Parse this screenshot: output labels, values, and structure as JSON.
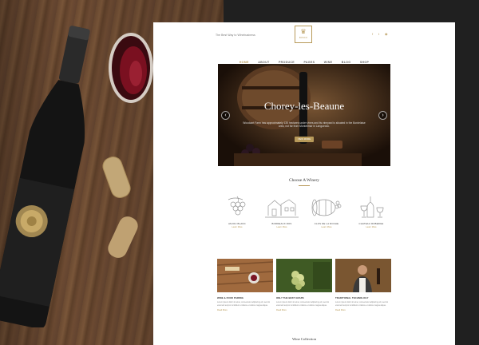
{
  "site": {
    "tagline": "The Best Way to Winebusiness",
    "logo_text": "BOSCO",
    "social_icons": [
      "facebook-icon",
      "twitter-icon",
      "rss-icon"
    ],
    "nav": [
      {
        "label": "HOME",
        "active": true
      },
      {
        "label": "ABOUT"
      },
      {
        "label": "PRODUCE"
      },
      {
        "label": "PAGES"
      },
      {
        "label": "WINE"
      },
      {
        "label": "BLOG"
      },
      {
        "label": "SHOP"
      }
    ]
  },
  "hero": {
    "title": "Chorey-les-Beaune",
    "text": "Woodcart Farm has approximately 135 hectares under vines and its vineyard is situated in the Bordelaise area, not far from Montelimar in Languedoc.",
    "button": "VIEW MORE"
  },
  "wineries": {
    "title": "Choose A Winery",
    "items": [
      {
        "name": "ANJOU BLANC",
        "link": "Learn More"
      },
      {
        "name": "BORDEAUX ROS",
        "link": "Learn More"
      },
      {
        "name": "CLOS DE LA ROCHE",
        "link": "Learn More"
      },
      {
        "name": "CHATEAU ROBERGE",
        "link": "Learn More"
      }
    ]
  },
  "posts": [
    {
      "title": "WINE & FOOD PAIRING",
      "text": "Lorem ipsum dolor sit amet, consectetur adipiscing elit, sed do eiusmod tempor incididunt ut labore et dolore magna aliqua.",
      "more": "Read More"
    },
    {
      "title": "ONLY THE BEST GRAPE",
      "text": "Lorem ipsum dolor sit amet, consectetur adipiscing elit, sed do eiusmod tempor incididunt ut labore et dolore magna aliqua.",
      "more": "Read More"
    },
    {
      "title": "TRADITIONAL TECHNOLOGY",
      "text": "Lorem ipsum dolor sit amet, consectetur adipiscing elit, sed do eiusmod tempor incididunt ut labore et dolore magna aliqua.",
      "more": "Read More"
    }
  ],
  "collection": {
    "title": "Wine Collection"
  },
  "colors": {
    "accent": "#b89a5a",
    "dark": "#202020",
    "wood": "#6b4a31"
  }
}
